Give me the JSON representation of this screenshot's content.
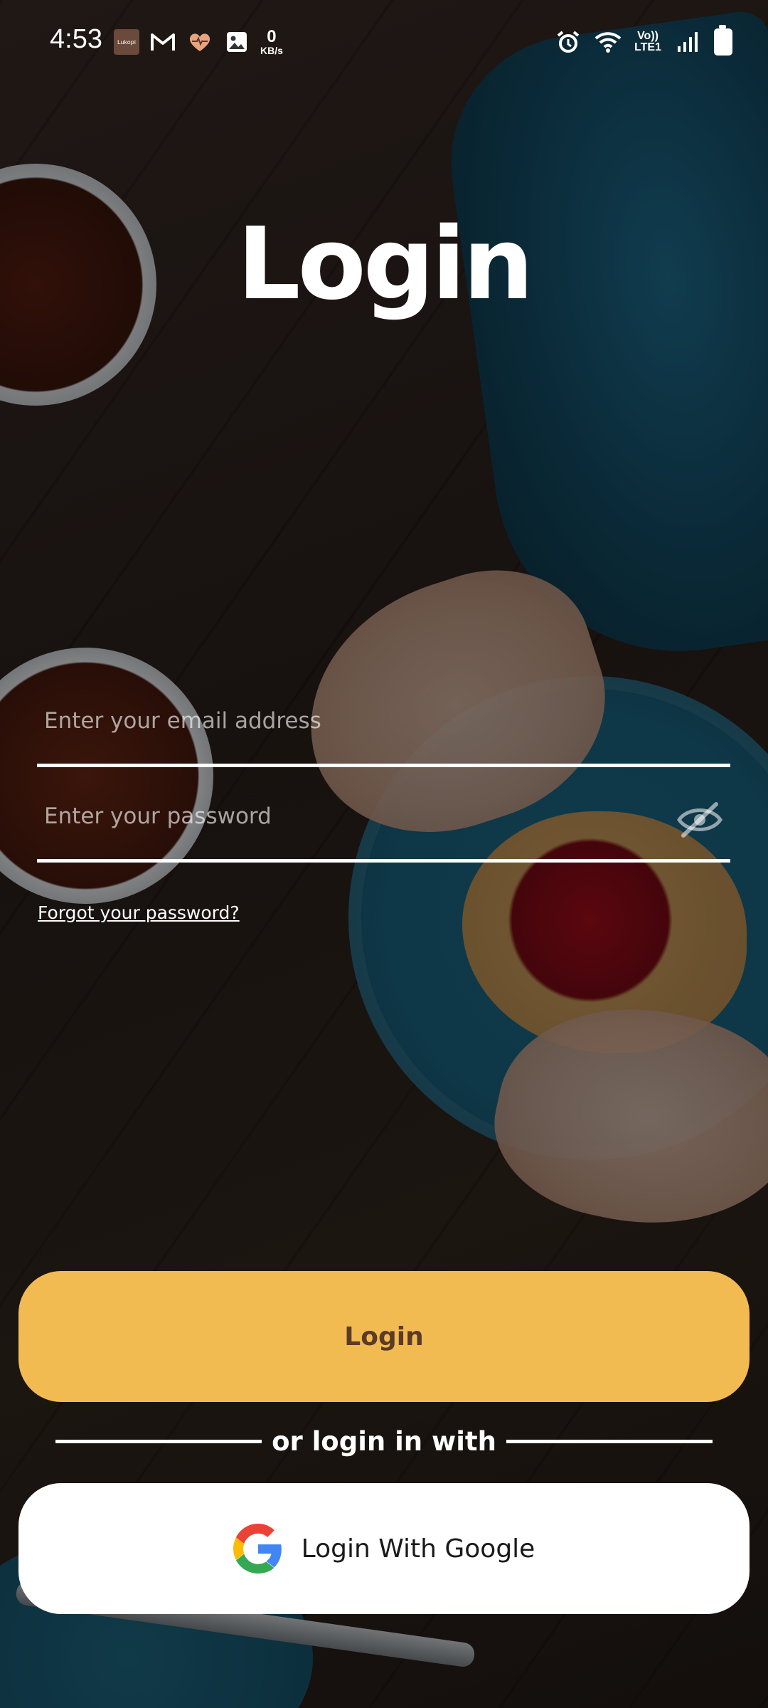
{
  "status_bar": {
    "time": "4:53",
    "app_icon_text": "Lukopi",
    "kb_value": "0",
    "kb_unit": "KB/s",
    "network_line1": "Vo))",
    "network_line2": "LTE1"
  },
  "title": "Login",
  "form": {
    "email_placeholder": "Enter your email address",
    "password_placeholder": "Enter your password",
    "forgot_password": "Forgot your password?"
  },
  "buttons": {
    "login_label": "Login",
    "divider_text": "or login in with",
    "google_label": "Login With Google"
  },
  "colors": {
    "accent": "#f2bb52",
    "accent_text": "#5b3b26"
  }
}
